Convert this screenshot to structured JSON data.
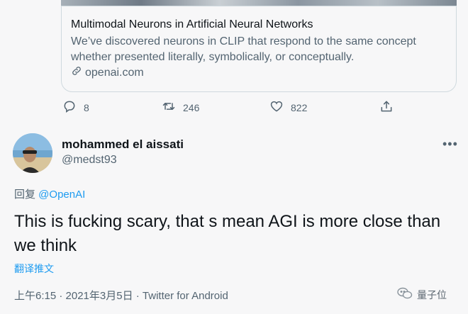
{
  "card": {
    "title": "Multimodal Neurons in Artificial Neural Networks",
    "description": "We’ve discovered neurons in CLIP that respond to the same concept whether presented literally, symbolically, or conceptually.",
    "domain": "openai.com"
  },
  "actions": {
    "replies": "8",
    "retweets": "246",
    "likes": "822"
  },
  "author": {
    "display_name": "mohammed el aissati",
    "handle": "@medst93",
    "more": "•••"
  },
  "reply": {
    "prefix": "回复 ",
    "mention": "@OpenAI"
  },
  "tweet": {
    "text": "This is fucking scary, that s mean AGI is more close than we think",
    "translate_label": "翻译推文"
  },
  "meta": {
    "line": "上午6:15 · 2021年3月5日 · Twitter for Android"
  },
  "watermark": {
    "text": "量子位"
  }
}
